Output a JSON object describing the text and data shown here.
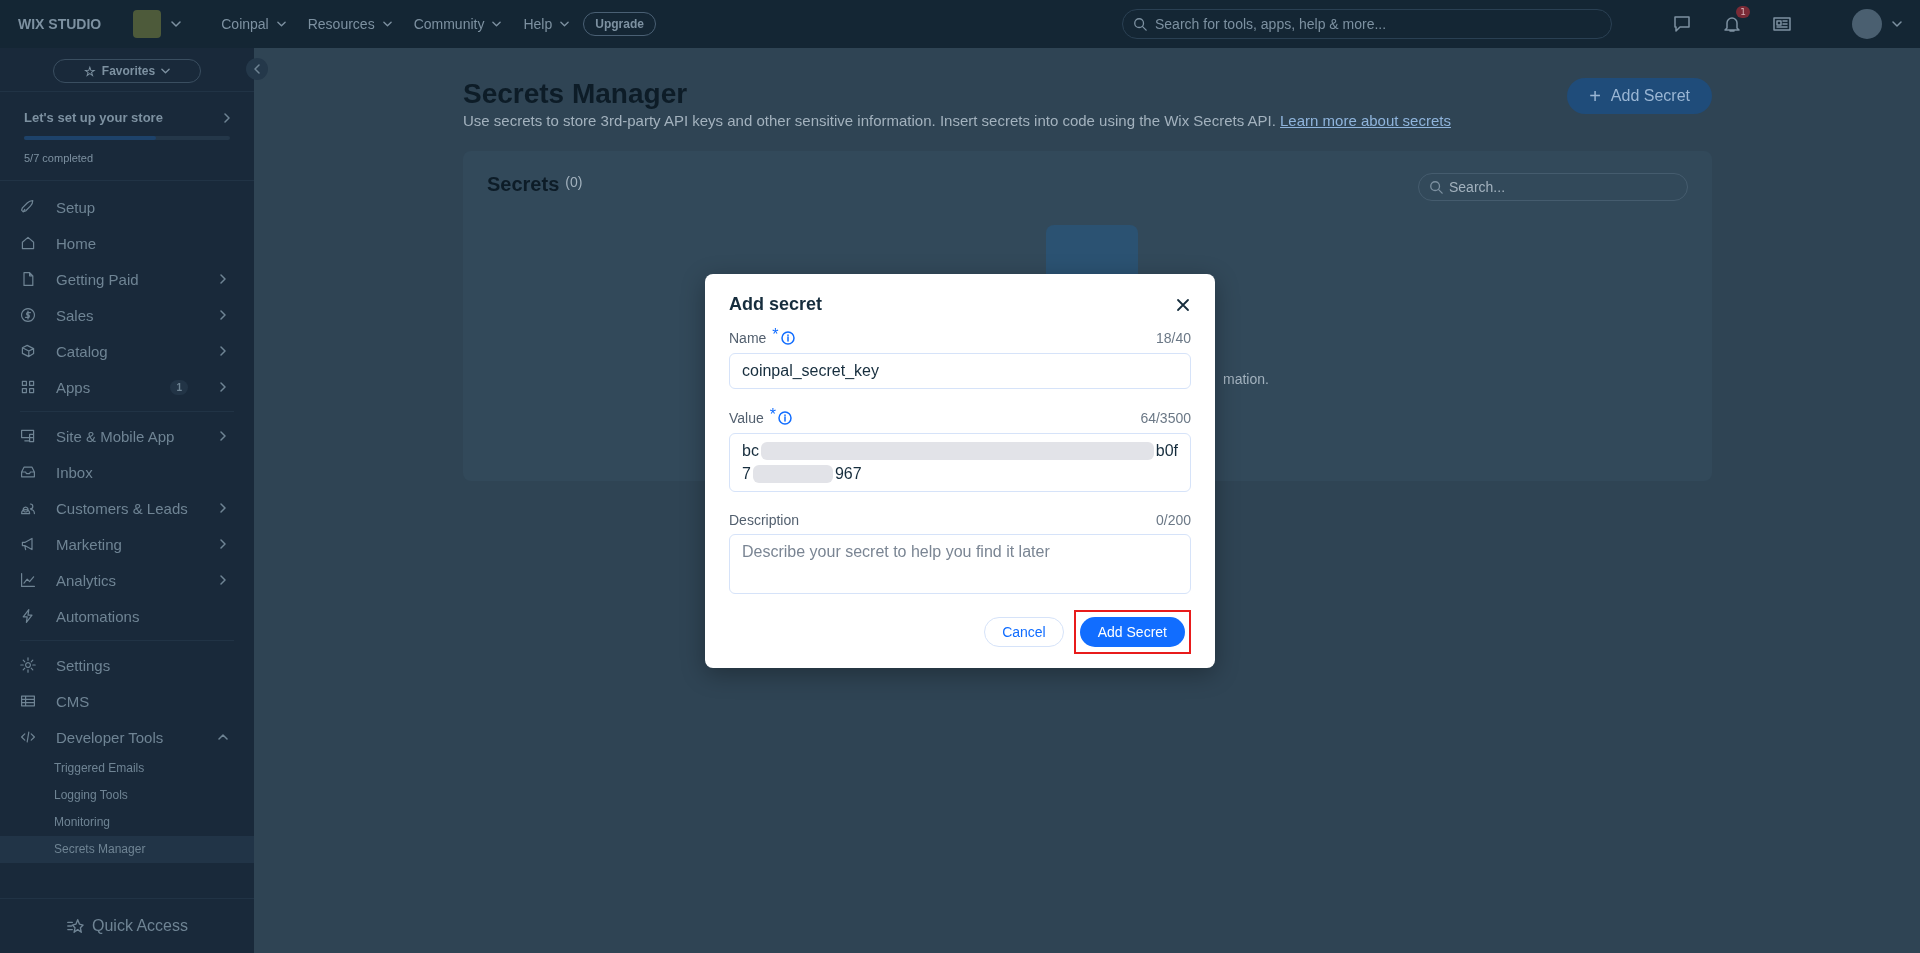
{
  "top_bar": {
    "logo": "WIX STUDIO",
    "menus": [
      {
        "label": "Coinpal"
      },
      {
        "label": "Resources"
      },
      {
        "label": "Community"
      },
      {
        "label": "Help"
      }
    ],
    "upgrade": "Upgrade",
    "search": {
      "placeholder": "Search for tools, apps, help & more..."
    },
    "notification_count": "1"
  },
  "sidebar": {
    "favorites": {
      "icon": "☆",
      "label": "Favorites"
    },
    "setup": {
      "title": "Let's set up your store",
      "level": 0.64,
      "completed": "5/7 completed"
    },
    "groups": [
      [
        {
          "label": "Setup",
          "chevron": false
        },
        {
          "label": "Home",
          "chevron": false
        },
        {
          "label": "Getting Paid",
          "chevron": true
        },
        {
          "label": "Sales",
          "chevron": true
        },
        {
          "label": "Catalog",
          "chevron": true
        },
        {
          "label": "Apps",
          "chevron": true,
          "badge": "1"
        }
      ],
      [
        {
          "label": "Site & Mobile App",
          "chevron": true
        },
        {
          "label": "Inbox",
          "chevron": false
        },
        {
          "label": "Customers & Leads",
          "chevron": true
        },
        {
          "label": "Marketing",
          "chevron": true
        },
        {
          "label": "Analytics",
          "chevron": true
        },
        {
          "label": "Automations",
          "chevron": false
        }
      ],
      [
        {
          "label": "Settings",
          "chevron": false
        },
        {
          "label": "CMS",
          "chevron": false
        },
        {
          "label": "Developer Tools",
          "chevron": true,
          "expanded": true,
          "children": [
            {
              "label": "Triggered Emails",
              "selected": false
            },
            {
              "label": "Logging Tools",
              "selected": false
            },
            {
              "label": "Monitoring",
              "selected": false
            },
            {
              "label": "Secrets Manager",
              "selected": true
            }
          ]
        }
      ]
    ],
    "quick_access": "Quick Access"
  },
  "page": {
    "title": "Secrets Manager",
    "description": "Use secrets to store 3rd-party API keys and other sensitive information. Insert secrets into code using the Wix Secrets API.",
    "link": "Learn more about secrets",
    "add_button": {
      "icon": "+",
      "label": "Add Secret"
    },
    "card": {
      "title": "Secrets",
      "count": "(0)",
      "search": {
        "placeholder": "Search..."
      },
      "empty_text_visible": "mation."
    }
  },
  "modal": {
    "title": "Add secret",
    "fields": [
      {
        "kind": "input",
        "label": "Name",
        "required_mark": "*",
        "counter": "18/40",
        "value": "coinpal_secret_key"
      },
      {
        "kind": "blurred",
        "label": "Value",
        "required_mark": "*",
        "counter": "64/3500",
        "lines": [
          {
            "start": "bc",
            "end": "b0f"
          },
          {
            "start": "7",
            "end": "967"
          }
        ]
      },
      {
        "kind": "textarea",
        "label": "Description",
        "counter": "0/200",
        "placeholder": "Describe your secret to help you find it later"
      }
    ],
    "cancel": "Cancel",
    "submit": {
      "label": "Add Secret",
      "highlighted": true
    }
  }
}
